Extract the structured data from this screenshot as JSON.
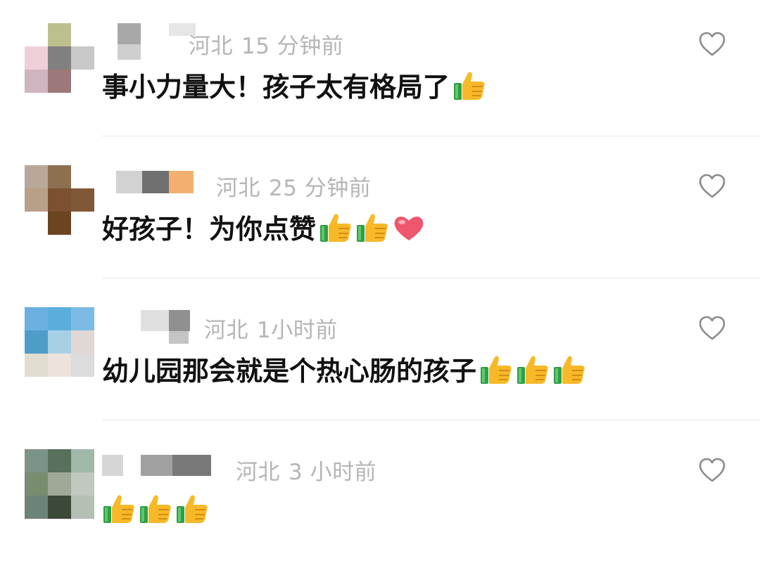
{
  "comments": [
    {
      "location": "河北",
      "time": "15 分钟前",
      "text": "事小力量大！孩子太有格局了",
      "emojis": [
        "thumbs-up"
      ],
      "avatar_colors": [
        "#ffffff",
        "#bcc08c",
        "#ffffff",
        "#f0d0d8",
        "#808080",
        "#c8c8c8",
        "#d0b4c0",
        "#9c7878",
        "#ffffff"
      ],
      "name_colors": [
        "#a8a8a8",
        "#cfcfcf",
        "#e6e6e6"
      ]
    },
    {
      "location": "河北",
      "time": "25 分钟前",
      "text": "好孩子！为你点赞",
      "emojis": [
        "thumbs-up",
        "thumbs-up",
        "heart"
      ],
      "avatar_colors": [
        "#b8a898",
        "#8c7050",
        "#ffffff",
        "#b8a088",
        "#7c5030",
        "#805838",
        "#ffffff",
        "#6c4420",
        "#ffffff"
      ],
      "name_colors": [
        "#d2d2d2",
        "#707070",
        "#f2b070"
      ]
    },
    {
      "location": "河北",
      "time": "1小时前",
      "text": "幼儿园那会就是个热心肠的孩子",
      "emojis": [
        "thumbs-up",
        "thumbs-up",
        "thumbs-up"
      ],
      "avatar_colors": [
        "#6ab0e0",
        "#5aaedc",
        "#7cbce4",
        "#4e9cc8",
        "#a8d0e4",
        "#e0d8d4",
        "#e0dcd0",
        "#ece4dc",
        "#dcdcdc"
      ],
      "name_colors": [
        "#e0e0e0",
        "#909090",
        "#c4c4c4"
      ]
    },
    {
      "location": "河北",
      "time": "3 小时前",
      "text": "",
      "emojis": [
        "thumbs-up",
        "thumbs-up",
        "thumbs-up"
      ],
      "avatar_colors": [
        "#7c9488",
        "#58705c",
        "#a0b8a8",
        "#788c70",
        "#a0a898",
        "#c0c8c0",
        "#6c8478",
        "#3c4838",
        "#b4c0b4"
      ],
      "name_colors": [
        "#d6d6d6",
        "#a0a0a0",
        "#787878"
      ]
    }
  ],
  "colors": {
    "meta_text": "#b5b5b5",
    "comment_text": "#111111",
    "divider": "#e6e6e6",
    "heart_outline": "#8a8a8a"
  }
}
